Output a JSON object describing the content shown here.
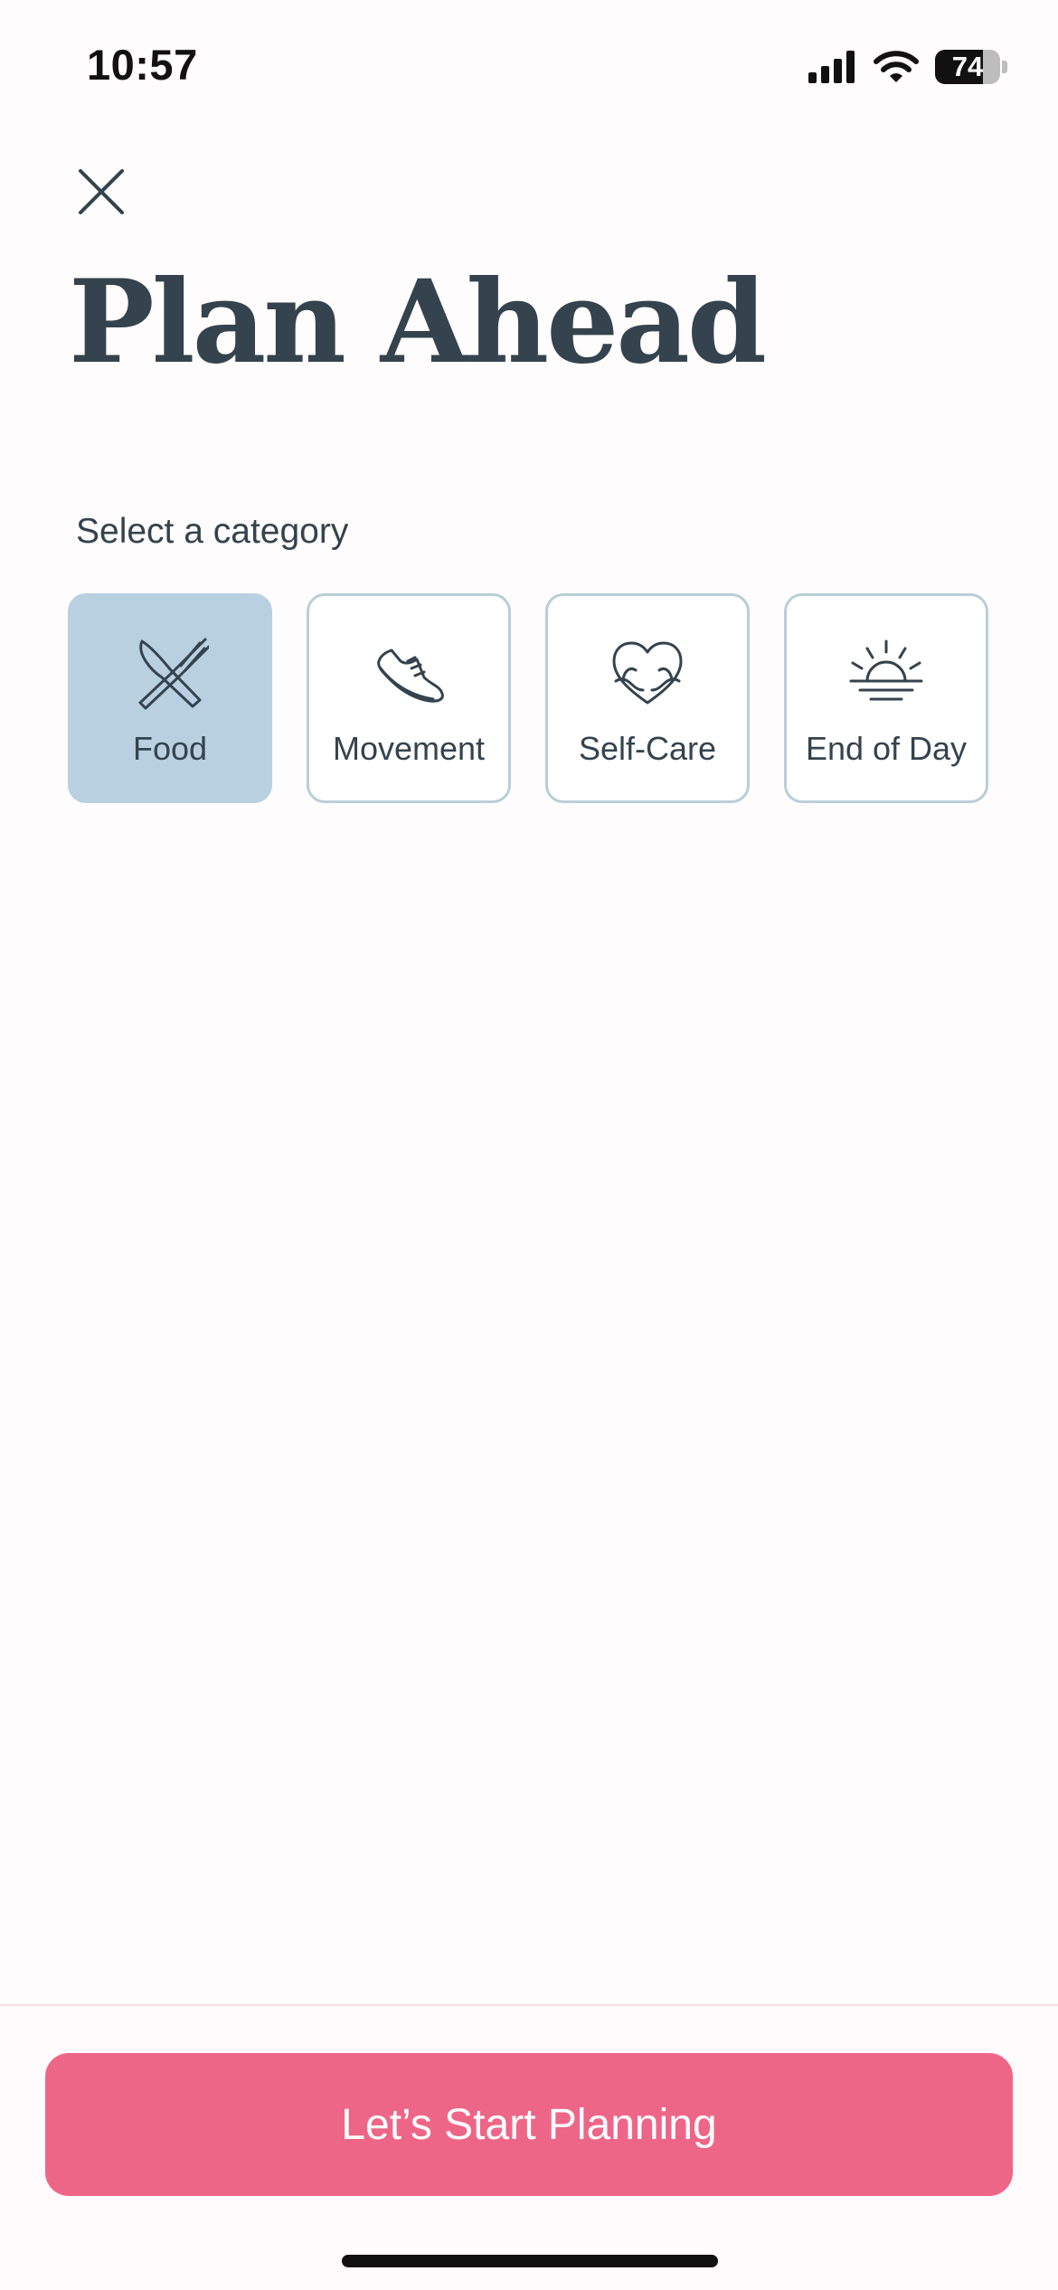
{
  "status_bar": {
    "time": "10:57",
    "battery_level": "74",
    "battery_fraction": 0.74,
    "icons": [
      "cellular-signal-icon",
      "wifi-icon",
      "battery-icon"
    ]
  },
  "header": {
    "close_icon": "close-icon",
    "title": "Plan Ahead"
  },
  "categories": {
    "label": "Select a category",
    "selected": "Food",
    "items": [
      {
        "label": "Food",
        "icon": "fork-knife-icon",
        "selected": true
      },
      {
        "label": "Movement",
        "icon": "sneaker-icon",
        "selected": false
      },
      {
        "label": "Self-Care",
        "icon": "heart-hug-icon",
        "selected": false
      },
      {
        "label": "End of Day",
        "icon": "sunset-icon",
        "selected": false
      }
    ]
  },
  "footer": {
    "primary_button": "Let’s Start Planning"
  },
  "colors": {
    "text": "#34434d",
    "accent": "#ee6687",
    "selected_card": "#b9d0e1",
    "card_border": "#b9ced9",
    "background": "#fffcfd"
  }
}
